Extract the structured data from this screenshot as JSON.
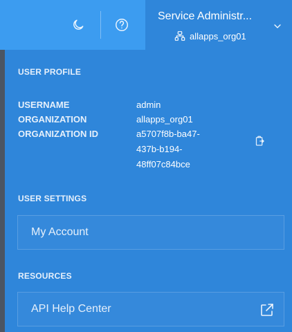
{
  "header": {
    "user_display_name": "Service Administr...",
    "org_name": "allapps_org01",
    "icons": {
      "theme": "moon-icon",
      "help": "help-icon",
      "org": "org-tree-icon",
      "dropdown": "chevron-down-icon"
    }
  },
  "user_profile": {
    "section_title": "USER PROFILE",
    "username_label": "USERNAME",
    "username_value": "admin",
    "organization_label": "ORGANIZATION",
    "organization_value": "allapps_org01",
    "organization_id_label": "ORGANIZATION ID",
    "organization_id_line1": "a5707f8b-ba47-",
    "organization_id_line2": "437b-b194-",
    "organization_id_line3": "48ff07c84bce",
    "copy_icon": "copy-icon"
  },
  "user_settings": {
    "section_title": "USER SETTINGS",
    "my_account_label": "My Account"
  },
  "resources": {
    "section_title": "RESOURCES",
    "api_help_center_label": "API Help Center",
    "external_icon": "external-link-icon"
  },
  "colors": {
    "header_bg": "#3c9cf0",
    "panel_bg": "#2f86da",
    "text": "#ffffff",
    "text_muted": "#e6f0fb"
  }
}
